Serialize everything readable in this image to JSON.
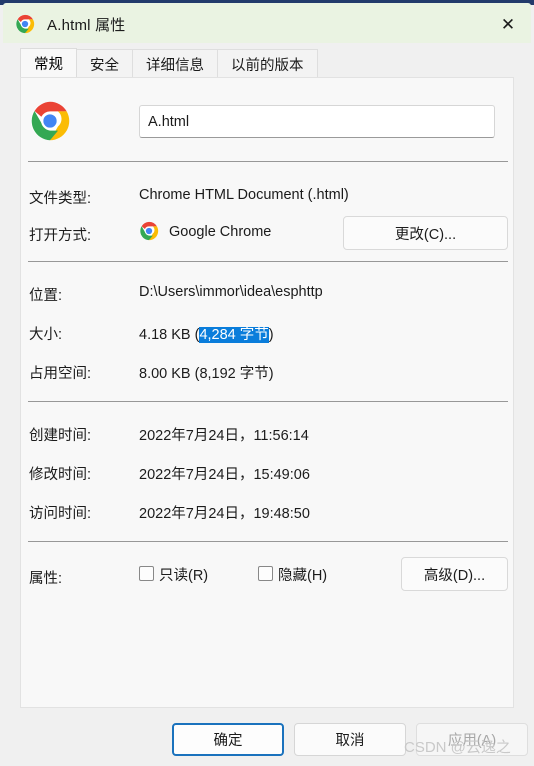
{
  "window": {
    "title": "A.html 属性",
    "icon": "chrome-icon",
    "close_label": "✕",
    "titlebar_color": "#eaf3e2",
    "accent_color": "#0a7ddb"
  },
  "tabs": [
    {
      "label": "常规",
      "active": true
    },
    {
      "label": "安全",
      "active": false
    },
    {
      "label": "详细信息",
      "active": false
    },
    {
      "label": "以前的版本",
      "active": false
    }
  ],
  "general": {
    "file_name_value": "A.html",
    "file_name_placeholder": "",
    "rows": [
      {
        "label": "文件类型:",
        "value": "Chrome HTML Document (.html)"
      },
      {
        "label": "打开方式:",
        "value": "Google Chrome"
      },
      {
        "label": "位置:",
        "value": "D:\\Users\\immor\\idea\\esphttp"
      },
      {
        "label": "大小:",
        "value": "4.18 KB (4,284 字节)"
      },
      {
        "label": "占用空间:",
        "value": "8.00 KB (8,192 字节)"
      },
      {
        "label": "创建时间:",
        "value": "2022年7月24日，11:56:14"
      },
      {
        "label": "修改时间:",
        "value": "2022年7月24日，15:49:06"
      },
      {
        "label": "访问时间:",
        "value": "2022年7月24日，19:48:50"
      },
      {
        "label": "属性:",
        "value": ""
      }
    ],
    "size_prefix": "4.18 KB (",
    "size_selected": "4,284 字节",
    "size_suffix": ")",
    "change_button": "更改(C)...",
    "advanced_button": "高级(D)...",
    "checkboxes": [
      {
        "label": "只读(R)",
        "checked": false
      },
      {
        "label": "隐藏(H)",
        "checked": false
      }
    ]
  },
  "footer": {
    "ok": "确定",
    "cancel": "取消",
    "apply": "应用(A)",
    "apply_disabled": true
  },
  "watermark": "CSDN @云逸之"
}
